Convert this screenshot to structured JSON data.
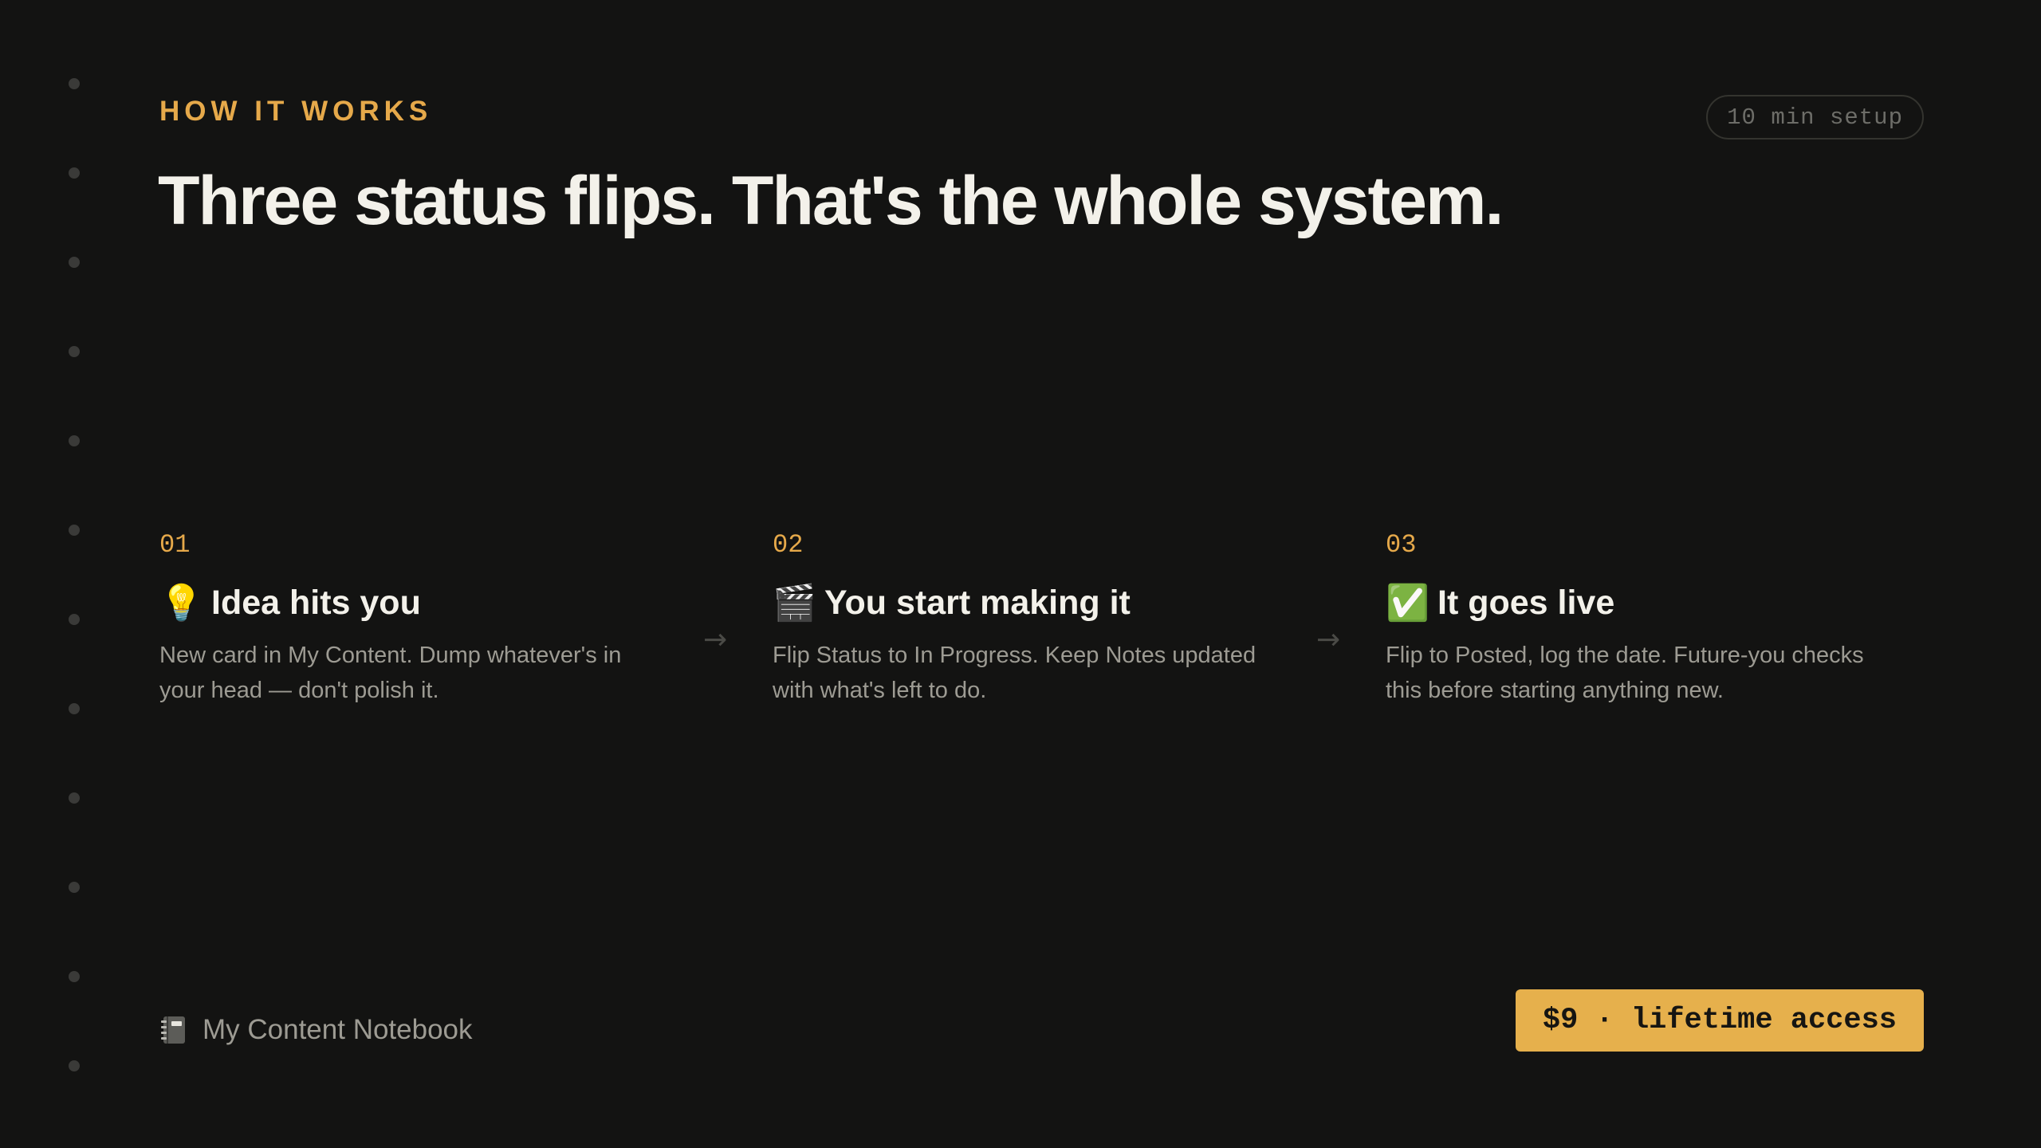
{
  "section": {
    "eyebrow": "HOW IT WORKS",
    "setup_badge": "10 min setup",
    "headline": "Three status flips. That's the whole system."
  },
  "steps": [
    {
      "number": "01",
      "icon": "light-bulb-icon",
      "emoji": "💡",
      "title": "Idea hits you",
      "description": "New card in My Content. Dump whatever's in your head — don't polish it."
    },
    {
      "number": "02",
      "icon": "clapper-board-icon",
      "emoji": "🎬",
      "title": "You start making it",
      "description": "Flip Status to In Progress. Keep Notes updated with what's left to do."
    },
    {
      "number": "03",
      "icon": "check-mark-icon",
      "emoji": "✅",
      "title": "It goes live",
      "description": "Flip to Posted, log the date. Future-you checks this before starting anything new."
    }
  ],
  "arrow_glyph": "→",
  "footer": {
    "brand_icon": "notebook-icon",
    "brand_name": "My Content Notebook",
    "cta_label": "$9 · lifetime access"
  },
  "colors": {
    "background": "#131312",
    "accent": "#e6a94a",
    "cta_background": "#e6b04c",
    "heading": "#f3f1ea",
    "body_text": "#9d9b93"
  }
}
